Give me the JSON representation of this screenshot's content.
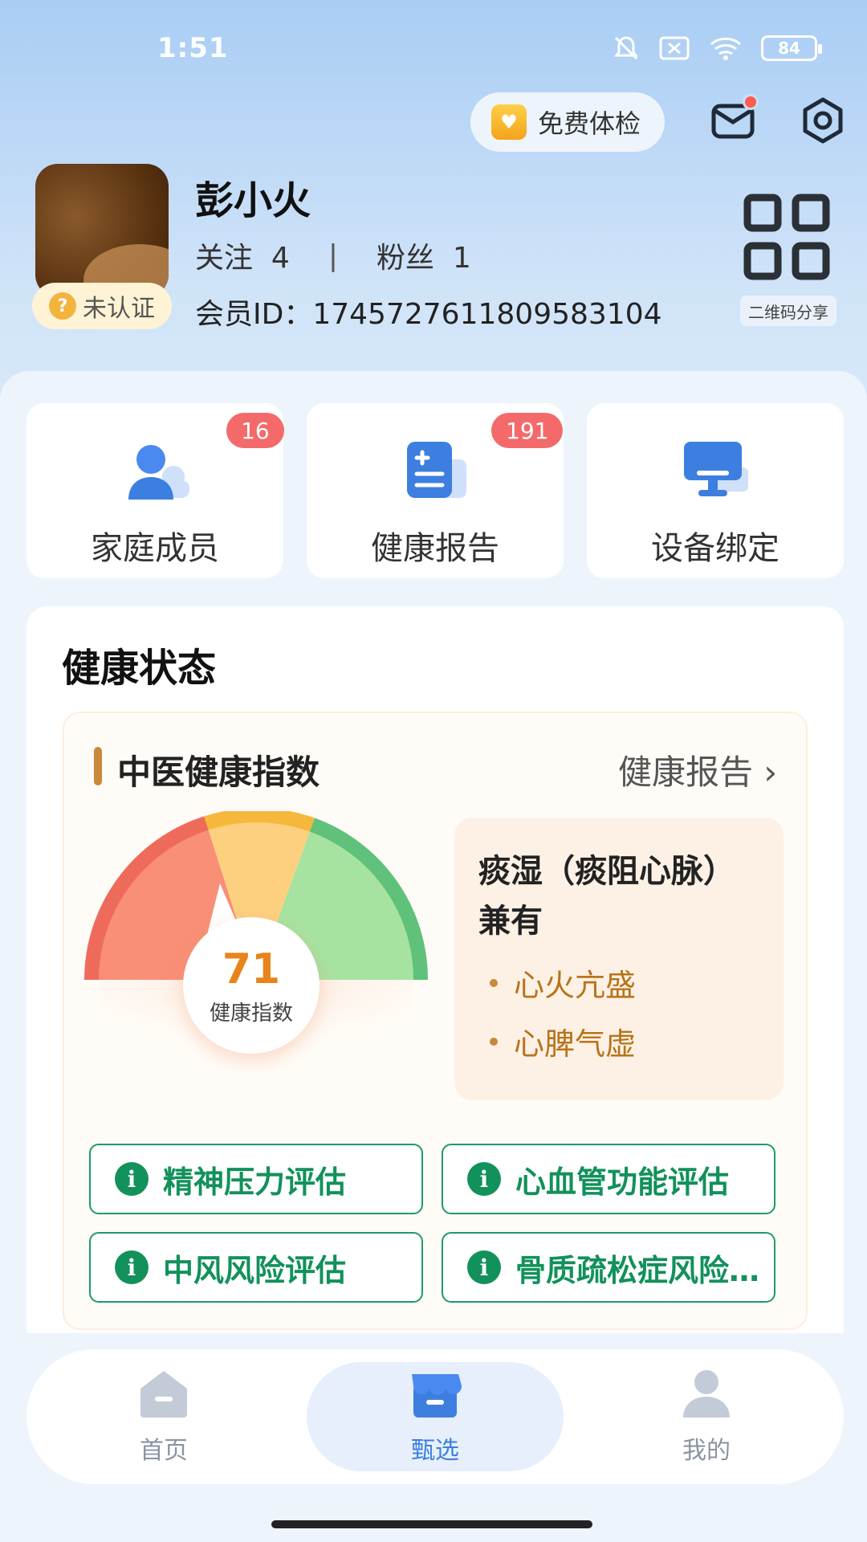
{
  "status_bar": {
    "time": "1:51",
    "battery": "84"
  },
  "header": {
    "free_checkup_label": "免费体检",
    "mail_has_unread": true
  },
  "profile": {
    "name": "彭小火",
    "follow_label": "关注",
    "follow_count": "4",
    "separator": "|",
    "fans_label": "粉丝",
    "fans_count": "1",
    "member_id": "会员ID：1745727611809583104",
    "verify_label": "未认证",
    "qr_label": "二维码分享"
  },
  "tiles": [
    {
      "label": "家庭成员",
      "badge": "16"
    },
    {
      "label": "健康报告",
      "badge": "191"
    },
    {
      "label": "设备绑定",
      "badge": ""
    }
  ],
  "health": {
    "title": "健康状态",
    "index_title": "中医健康指数",
    "report_link": "健康报告 ›",
    "score": 71,
    "score_caption": "健康指数",
    "constitution_main": "痰湿（痰阻心脉）兼有",
    "constitution_items": [
      "心火亢盛",
      "心脾气虚"
    ],
    "evaluations": [
      "精神压力评估",
      "心血管功能评估",
      "中风风险评估",
      "骨质疏松症风险…"
    ]
  },
  "colors": {
    "accent": "#3d7fe0",
    "eval_green": "#12915b",
    "badge_red": "#f46a6a",
    "tcm_orange": "#b8741a"
  },
  "tabbar": [
    {
      "label": "首页",
      "icon": "home-icon",
      "active": false
    },
    {
      "label": "甄选",
      "icon": "store-icon",
      "active": true
    },
    {
      "label": "我的",
      "icon": "profile-icon",
      "active": false
    }
  ]
}
